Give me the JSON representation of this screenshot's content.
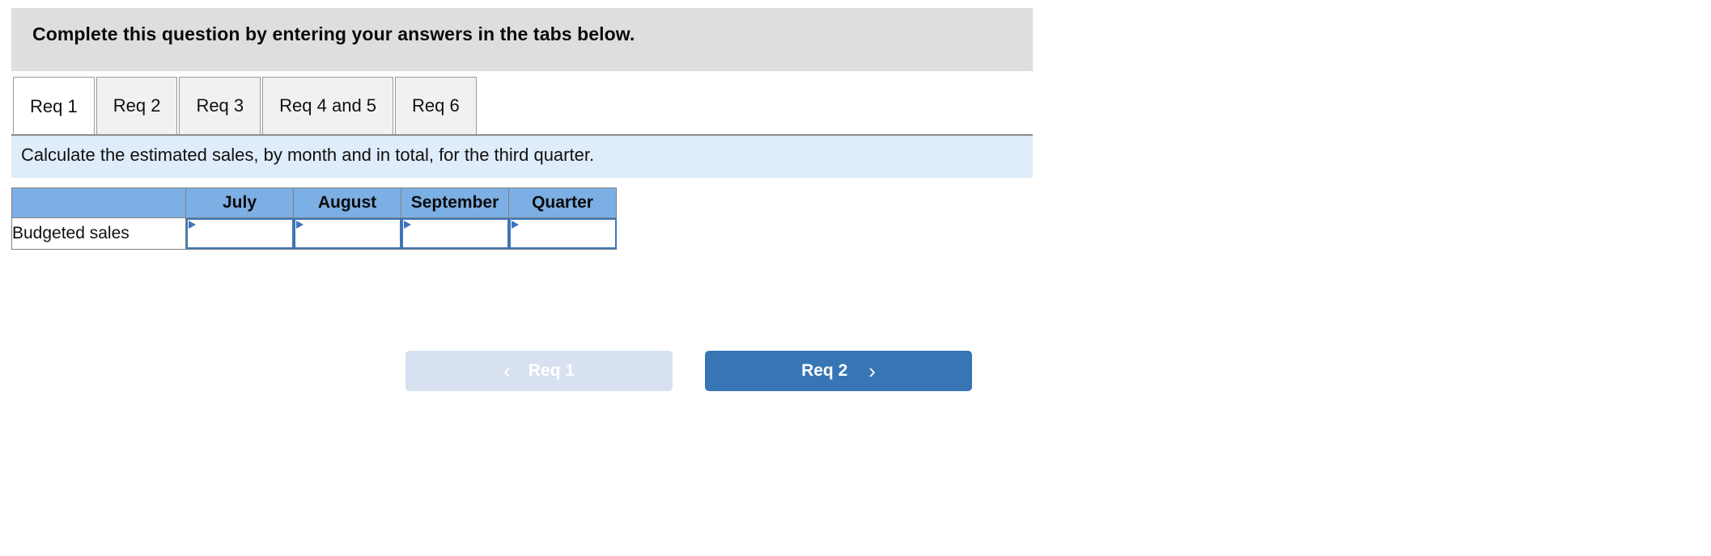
{
  "header": {
    "instruction": "Complete this question by entering your answers in the tabs below."
  },
  "tabs": {
    "items": [
      {
        "label": "Req 1",
        "active": true
      },
      {
        "label": "Req 2",
        "active": false
      },
      {
        "label": "Req 3",
        "active": false
      },
      {
        "label": "Req 4 and 5",
        "active": false
      },
      {
        "label": "Req 6",
        "active": false
      }
    ]
  },
  "requirement": {
    "text": "Calculate the estimated sales, by month and in total, for the third quarter."
  },
  "table": {
    "columns": [
      "",
      "July",
      "August",
      "September",
      "Quarter"
    ],
    "rows": [
      {
        "label": "Budgeted sales",
        "values": [
          "",
          "",
          "",
          ""
        ]
      }
    ]
  },
  "navigation": {
    "prev": {
      "label": "Req 1",
      "icon": "chevron-left-icon",
      "glyph": "‹",
      "disabled": true
    },
    "next": {
      "label": "Req 2",
      "icon": "chevron-right-icon",
      "glyph": "›",
      "disabled": false
    }
  },
  "colors": {
    "header_gray": "#dedede",
    "banner_blue": "#dfecf9",
    "table_header_blue": "#7cafe4",
    "input_border_blue": "#3d76b8",
    "button_active_blue": "#3875b5",
    "button_disabled_blue": "#d7e1ef"
  }
}
